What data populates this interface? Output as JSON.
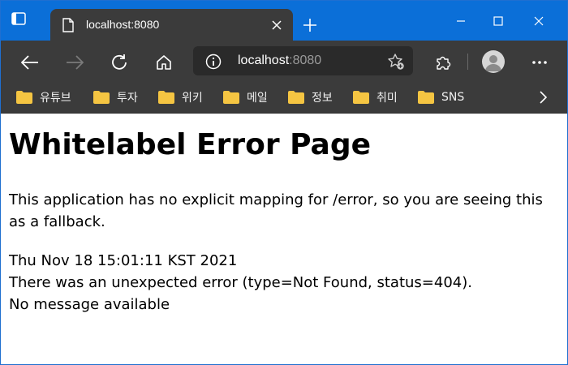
{
  "browser": {
    "tab": {
      "title": "localhost:8080",
      "favicon": "page-icon"
    },
    "address": {
      "host": "localhost",
      "port": ":8080"
    },
    "colors": {
      "titlebar": "#0b6fd8",
      "toolbar": "#3b3b3b",
      "folder": "#f5c542"
    }
  },
  "bookmarks": [
    {
      "label": "유튜브"
    },
    {
      "label": "투자"
    },
    {
      "label": "위키"
    },
    {
      "label": "메일"
    },
    {
      "label": "정보"
    },
    {
      "label": "취미"
    },
    {
      "label": "SNS"
    }
  ],
  "page": {
    "title": "Whitelabel Error Page",
    "explanation": "This application has no explicit mapping for /error, so you are seeing this as a fallback.",
    "timestamp": "Thu Nov 18 15:01:11 KST 2021",
    "error_line": "There was an unexpected error (type=Not Found, status=404).",
    "message": "No message available"
  }
}
